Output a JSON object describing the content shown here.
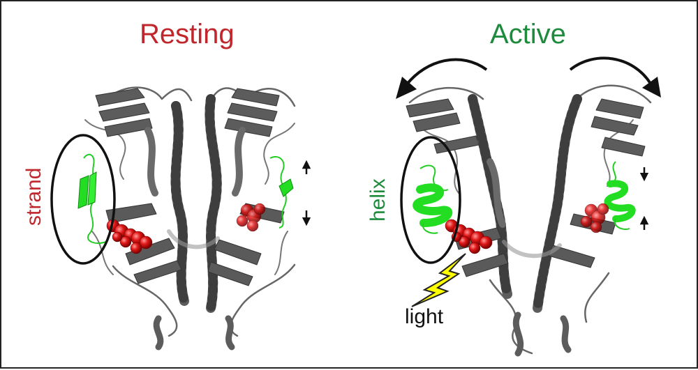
{
  "panels": {
    "resting": {
      "title": "Resting",
      "side_label": "strand"
    },
    "active": {
      "title": "Active",
      "side_label": "helix",
      "trigger_label": "light"
    }
  },
  "colors": {
    "resting": "#c0272d",
    "active": "#1e8a3c",
    "protein": "#5a5a5a",
    "chromophore": "#e01818",
    "secondary_element": "#22dd22",
    "light_bolt": "#ffff00"
  }
}
